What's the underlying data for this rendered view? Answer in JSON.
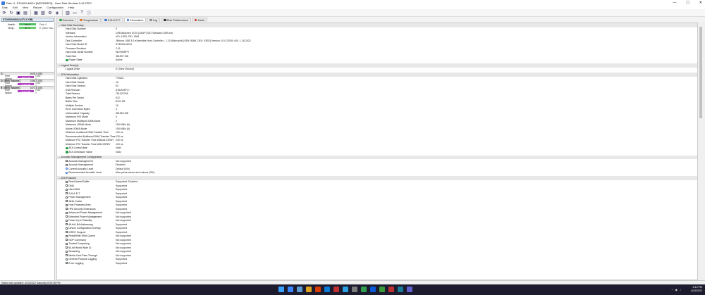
{
  "window": {
    "title": "Disk: 0, ST4000LM024 [WDF65RP9] - Hard Disk Sentinel 5.61 PRO",
    "minimize": "—",
    "maximize": "☐",
    "close": "✕"
  },
  "menu": [
    "Disk",
    "Edit",
    "View",
    "Report",
    "Configuration",
    "Help"
  ],
  "toolbar_icons": [
    "refresh-icon",
    "refresh-all-icon",
    "save-icon",
    "report-icon",
    "test-icon",
    "surface-test-icon",
    "settings-icon",
    "alert-icon",
    "disk-icon",
    "monitor-icon",
    "help-icon",
    "info-icon"
  ],
  "left": {
    "disk": {
      "name": "ST4000LM024",
      "size": "(372.6 GB)",
      "health_label": "Health:",
      "health_value": "100 %",
      "health_right": "Disk: 0",
      "temp_label": "Temp.:",
      "temp_value": "37 °C",
      "temp_right": "E: [New Volu"
    },
    "volumes": [
      {
        "name": "C:",
        "size": "(928.0 GB)",
        "free_label": "Free Space",
        "free_value": "451.2 GB",
        "disk": "Disk: 0"
      },
      {
        "name": "D: [New Volume]",
        "size": "(186.0 GB)",
        "free_label": "Free Space",
        "free_value": "174.5 GB",
        "disk": "Disk: 0"
      },
      {
        "name": "E: [New Volume]",
        "size": "(372.6 GB)",
        "free_label": "Free Space",
        "free_value": "372.5 GB",
        "disk": "Disk: 0"
      }
    ]
  },
  "tabs": [
    {
      "label": "Overview",
      "color": "#2a9d46",
      "active": false
    },
    {
      "label": "Temperature",
      "color": "#e07020",
      "active": false
    },
    {
      "label": "S.M.A.R.T.",
      "color": "#3070d0",
      "active": false
    },
    {
      "label": "Information",
      "color": "#3070d0",
      "active": true
    },
    {
      "label": "Log",
      "color": "#8a8a8a",
      "active": false
    },
    {
      "label": "Disk Performance",
      "color": "#2a2a2a",
      "active": false
    },
    {
      "label": "Alerts",
      "color": "#d03030",
      "active": false
    }
  ],
  "sections": [
    {
      "title": "Hard Disk Summary",
      "rows": [
        [
          "Hard Disk Number",
          "0",
          ""
        ],
        [
          "Interface",
          "USB Attached SCSI (UASP) SAT Standard USB Info",
          ""
        ],
        [
          "Vendor Information",
          "VID: 152D, PID: 0561",
          ""
        ],
        [
          "Disk Controller",
          "JMicron USB 3.0 eXtensible Host Controller - 1.20 (Microsoft) [VEN: 8086, DEV: 43ED] Version: 10.0.22000.400, 1-18-2022",
          ""
        ],
        [
          "Hard Disk Model ID",
          "ST4000LM024",
          ""
        ],
        [
          "Firmware Revision",
          "2.01",
          ""
        ],
        [
          "Hard Disk Serial Number",
          "WDF65RP9",
          ""
        ],
        [
          "Total Size",
          "381597 MB",
          ""
        ],
        [
          "Power State",
          "Active",
          "ok"
        ]
      ]
    },
    {
      "title": "Logical Drive(s)",
      "rows": [
        [
          "Logical Drive",
          "E: [New Volume]",
          ""
        ]
      ]
    },
    {
      "title": "ATA Information",
      "rows": [
        [
          "Hard Disk Cylinders",
          "775221",
          ""
        ],
        [
          "Hard Disk Heads",
          "16",
          ""
        ],
        [
          "Hard Disk Sectors",
          "63",
          ""
        ],
        [
          "ATA Revision",
          "ATA/ATAPI-7",
          ""
        ],
        [
          "Total Sectors",
          "781422768",
          ""
        ],
        [
          "Bytes Per Sector",
          "512",
          ""
        ],
        [
          "Buffer Size",
          "8192 KB",
          ""
        ],
        [
          "Multiple Sectors",
          "16",
          ""
        ],
        [
          "Error Correction Bytes",
          "4",
          ""
        ],
        [
          "Unformatted Capacity",
          "381554 MB",
          ""
        ],
        [
          "Maximum PIO Mode",
          "4",
          ""
        ],
        [
          "Maximum Multiword DMA Mode",
          "2",
          ""
        ],
        [
          "Maximum UDMA Mode",
          "150 MB/s (6)",
          ""
        ],
        [
          "Active UDMA Mode",
          "150 MB/s (6)",
          ""
        ],
        [
          "Minimum multiword DMA Transfer Time",
          "120 ns",
          ""
        ],
        [
          "Recommended Multiword DMA Transfer Time",
          "120 ns",
          ""
        ],
        [
          "Minimum PIO Transfer Time Without IORDY",
          "240 ns",
          ""
        ],
        [
          "Minimum PIO Transfer Time With IORDY",
          "120 ns",
          ""
        ],
        [
          "ATA Control Byte",
          "Valid",
          "ok"
        ],
        [
          "ATA Checksum Value",
          "Valid",
          "ok"
        ]
      ]
    },
    {
      "title": "Acoustic Management Configuration",
      "rows": [
        [
          "Acoustic Management",
          "Not supported",
          "box"
        ],
        [
          "Acoustic Management",
          "Disabled",
          "box"
        ],
        [
          "Current Acoustic Level",
          "Default (00h)",
          "info"
        ],
        [
          "Recommended Acoustic Level",
          "Max performance and volume (00h)",
          "info"
        ]
      ]
    },
    {
      "title": "ATA Features",
      "rows": [
        [
          "Read Ahead Buffer",
          "Supported, Enabled",
          "checked"
        ],
        [
          "DMA",
          "Supported",
          "checked"
        ],
        [
          "Ultra DMA",
          "Supported",
          "checked"
        ],
        [
          "S.M.A.R.T.",
          "Supported",
          "checked"
        ],
        [
          "Power Management",
          "Supported",
          "checked"
        ],
        [
          "Write Cache",
          "Supported",
          "checked"
        ],
        [
          "Host Protected Area",
          "Supported",
          "checked"
        ],
        [
          "HPA Security Extensions",
          "Supported",
          "checked"
        ],
        [
          "Advanced Power Management",
          "Not supported",
          "box"
        ],
        [
          "Extended Power Management",
          "Not supported",
          "box"
        ],
        [
          "Power Up In Standby",
          "Not supported",
          "box"
        ],
        [
          "48-bit LBA Addressing",
          "Supported",
          "checked"
        ],
        [
          "Device Configuration Overlay",
          "Supported",
          "checked"
        ],
        [
          "IORDY Support",
          "Supported",
          "checked"
        ],
        [
          "Read/Write DMA Queue",
          "Not supported",
          "box"
        ],
        [
          "NOP Command",
          "Not supported",
          "box"
        ],
        [
          "Trusted Computing",
          "Not supported",
          "box"
        ],
        [
          "64-bit World Wide ID",
          "Not supported",
          "box"
        ],
        [
          "Streaming",
          "Not supported",
          "box"
        ],
        [
          "Media Card Pass Through",
          "Not supported",
          "box"
        ],
        [
          "General Purpose Logging",
          "Supported",
          "checked"
        ],
        [
          "Error Logging",
          "Supported",
          "checked"
        ]
      ]
    }
  ],
  "status": "Status last updated: 4/23/2022 Saturday 6:09:38 PM",
  "taskbar": {
    "icons": [
      "#3a86ff",
      "#5a9bd4",
      "#e0a020",
      "#d83b01",
      "#0a7cd8",
      "#c03030",
      "#2aa0e0",
      "#7a7a7a",
      "#30a050",
      "#0a5ad8",
      "#3a9a3a",
      "#c03030",
      "#1a7a9a",
      "#6060d0"
    ],
    "time": "6:10 PM",
    "date": "4/23/2022",
    "tray_chevron": "^",
    "tray_wifi": "◉",
    "tray_volume": "♪"
  }
}
